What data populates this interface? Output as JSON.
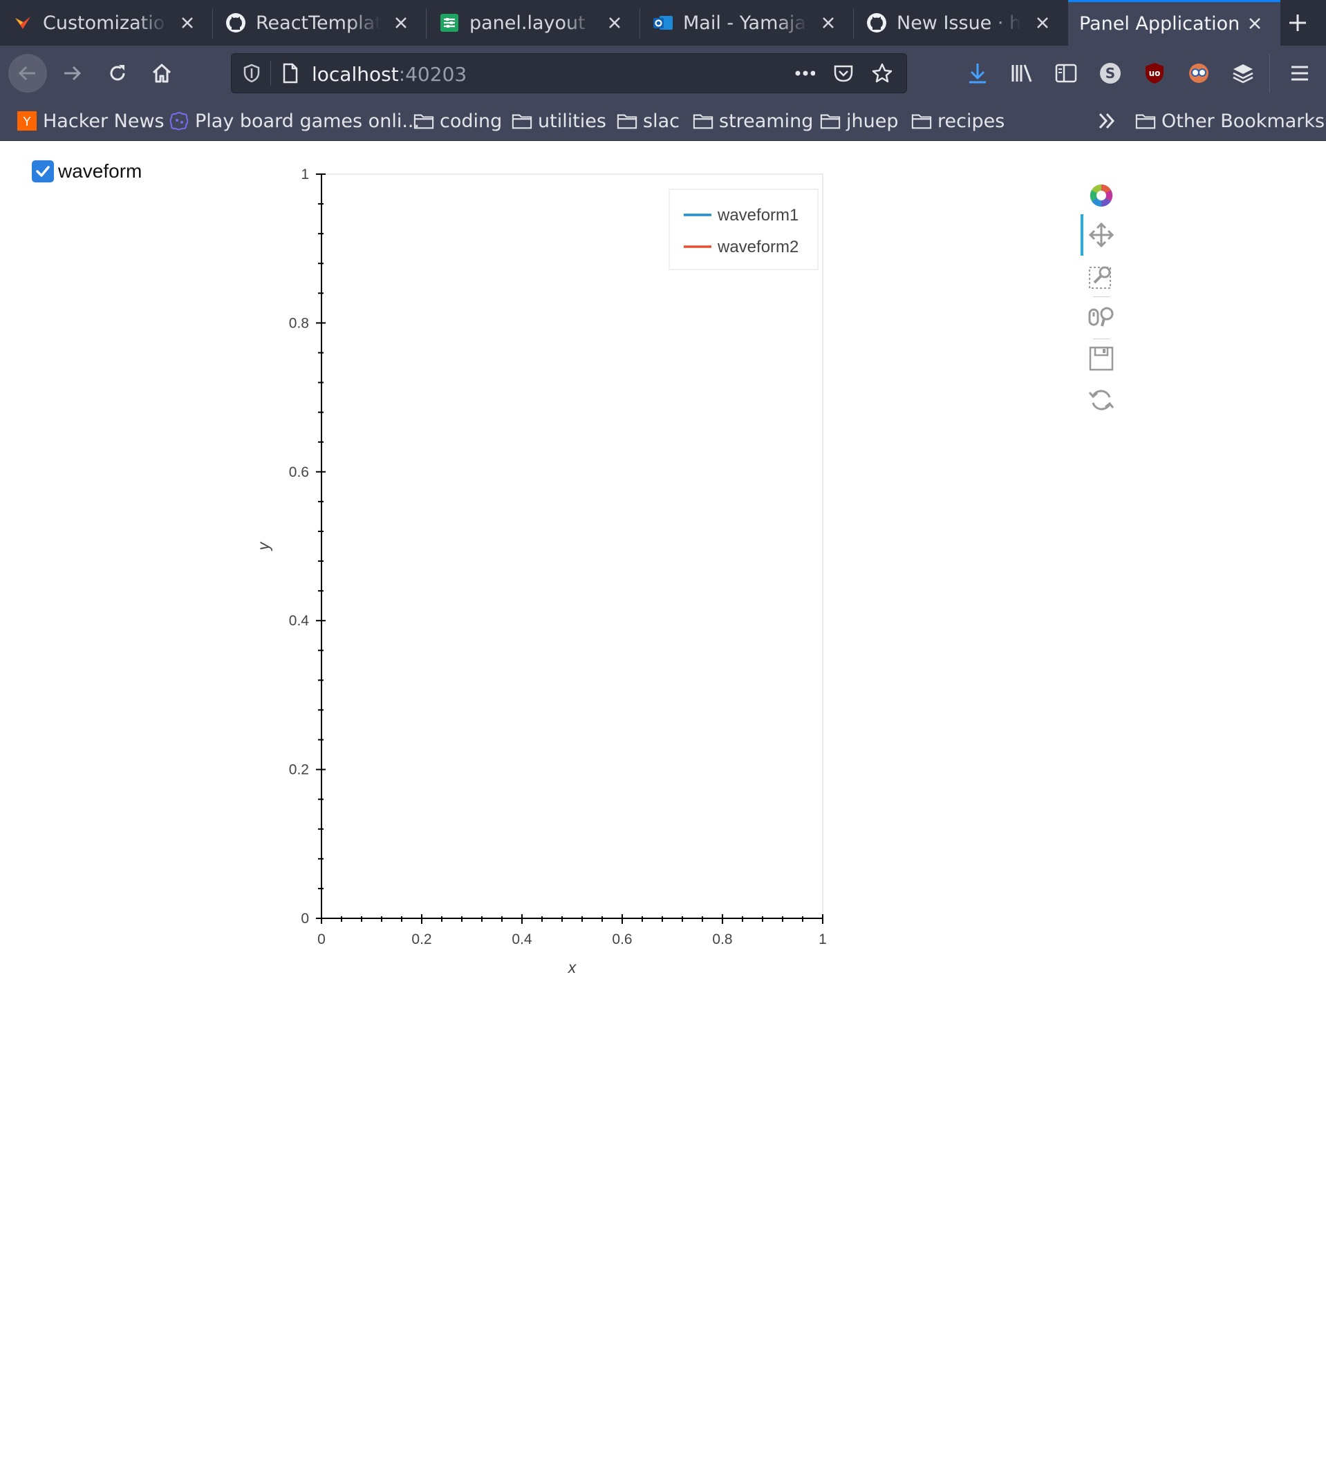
{
  "browser": {
    "tabs": [
      {
        "label": "Customization - ",
        "icon": "vivaldi-like-favicon"
      },
      {
        "label": "ReactTemplate · ",
        "icon": "github-icon"
      },
      {
        "label": "panel.layout Pa",
        "icon": "sheets-icon"
      },
      {
        "label": "Mail - Yamajala,",
        "icon": "outlook-icon"
      },
      {
        "label": "New Issue · hol",
        "icon": "github-icon"
      },
      {
        "label": "Panel Application",
        "icon": "none",
        "active": true
      }
    ],
    "url": {
      "host": "localhost",
      "port": ":40203"
    },
    "bookmarks": [
      {
        "label": "Hacker News",
        "icon": "hacker-news-icon"
      },
      {
        "label": "Play board games onli...",
        "icon": "boardgame-icon"
      },
      {
        "label": "coding",
        "icon": "folder-icon"
      },
      {
        "label": "utilities",
        "icon": "folder-icon"
      },
      {
        "label": "slac",
        "icon": "folder-icon"
      },
      {
        "label": "streaming",
        "icon": "folder-icon"
      },
      {
        "label": "jhuep",
        "icon": "folder-icon"
      },
      {
        "label": "recipes",
        "icon": "folder-icon"
      }
    ],
    "other_bookmarks": "Other Bookmarks",
    "accent_color": "#0a84ff"
  },
  "app": {
    "checkbox": {
      "label": "waveform",
      "checked": true,
      "color": "#2b7fde"
    }
  },
  "chart_data": {
    "type": "line",
    "title": "",
    "xlabel": "x",
    "ylabel": "y",
    "xlim": [
      0,
      1
    ],
    "ylim": [
      0,
      1
    ],
    "x_ticks": [
      "0",
      "0.2",
      "0.4",
      "0.6",
      "0.8",
      "1"
    ],
    "y_ticks": [
      "0",
      "0.2",
      "0.4",
      "0.6",
      "0.8",
      "1"
    ],
    "series": [
      {
        "name": "waveform1",
        "color": "#1f8fd0",
        "x": [],
        "y": []
      },
      {
        "name": "waveform2",
        "color": "#ef4b2f",
        "x": [],
        "y": []
      }
    ],
    "legend": "top-right",
    "grid": false,
    "toolbar": [
      "bokeh-logo-icon",
      "pan-icon",
      "box-zoom-icon",
      "wheel-zoom-icon",
      "save-icon",
      "reset-icon"
    ]
  }
}
